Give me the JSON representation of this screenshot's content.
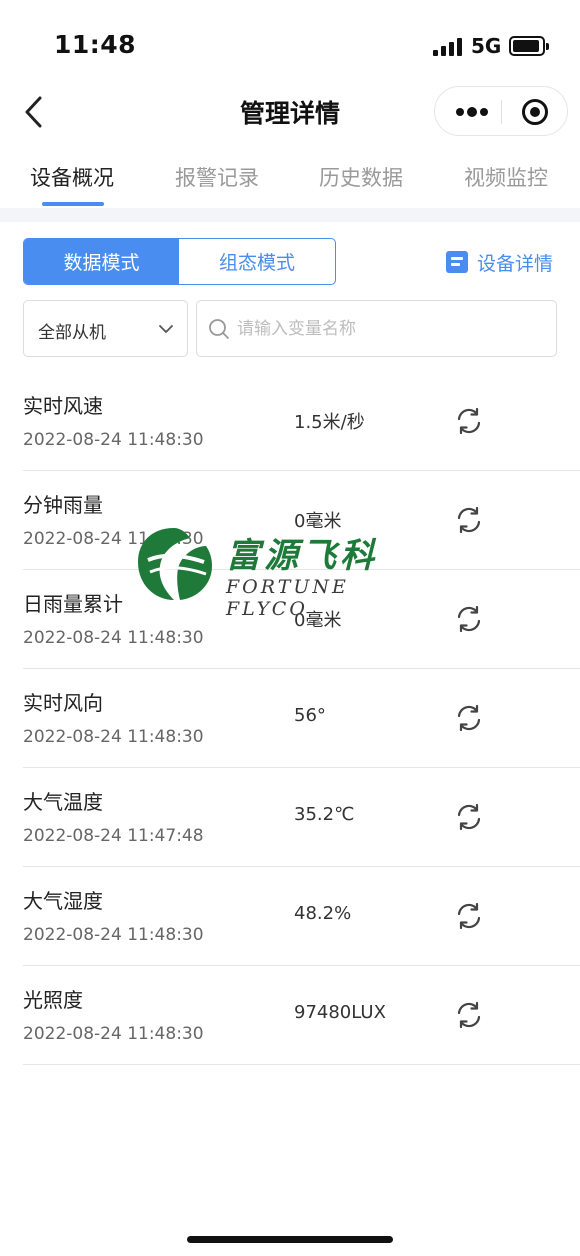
{
  "status_bar": {
    "time": "11:48",
    "network": "5G"
  },
  "nav": {
    "title": "管理详情"
  },
  "tabs": [
    {
      "label": "设备概况",
      "active": true
    },
    {
      "label": "报警记录",
      "active": false
    },
    {
      "label": "历史数据",
      "active": false
    },
    {
      "label": "视频监控",
      "active": false
    }
  ],
  "mode": {
    "data_mode": "数据模式",
    "config_mode": "组态模式",
    "active": "数据模式"
  },
  "device_detail_label": "设备详情",
  "filter": {
    "slave_selected": "全部从机",
    "search_placeholder": "请输入变量名称"
  },
  "rows": [
    {
      "name": "实时风速",
      "time": "2022-08-24 11:48:30",
      "value": "1.5米/秒"
    },
    {
      "name": "分钟雨量",
      "time": "2022-08-24 11:48:30",
      "value": "0毫米"
    },
    {
      "name": "日雨量累计",
      "time": "2022-08-24 11:48:30",
      "value": "0毫米"
    },
    {
      "name": "实时风向",
      "time": "2022-08-24 11:48:30",
      "value": "56°"
    },
    {
      "name": "大气温度",
      "time": "2022-08-24 11:47:48",
      "value": "35.2℃"
    },
    {
      "name": "大气湿度",
      "time": "2022-08-24 11:48:30",
      "value": "48.2%"
    },
    {
      "name": "光照度",
      "time": "2022-08-24 11:48:30",
      "value": "97480LUX"
    }
  ],
  "watermark": {
    "cn": "富源飞科",
    "en": "FORTUNE FLYCO"
  },
  "colors": {
    "accent": "#4a8df0",
    "brand_green": "#1f7a3a"
  },
  "icons": [
    "back-icon",
    "more-icon",
    "target-icon",
    "document-icon",
    "chevron-down-icon",
    "search-icon",
    "refresh-icon"
  ]
}
